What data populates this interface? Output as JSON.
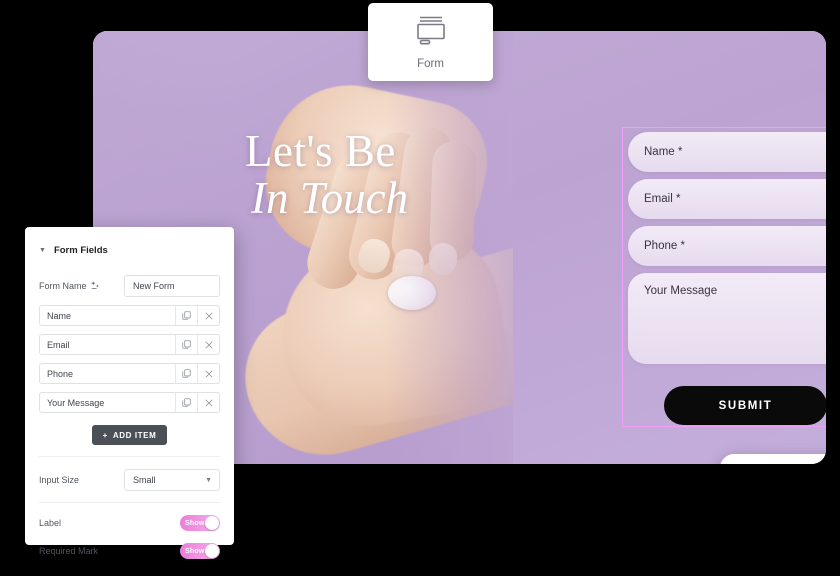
{
  "widget_chip": {
    "label": "Form",
    "icon": "form-widget-icon"
  },
  "hero": {
    "heading_line1": "Let's Be",
    "heading_line2": "In Touch"
  },
  "preview_form": {
    "fields": [
      {
        "label": "Name *"
      },
      {
        "label": "Email *"
      },
      {
        "label": "Phone *"
      },
      {
        "label": "Your Message"
      }
    ],
    "submit_label": "SUBMIT",
    "edit_badge_icon": "pencil-icon",
    "selection_color": "#ef9ff5"
  },
  "toast": {
    "status_icon": "check-icon",
    "check_color": "#0f5c3e",
    "avatars": [
      {
        "name": "avatar-1",
        "bg": "#f7c9dd"
      },
      {
        "name": "avatar-2",
        "bg": "#f0a55a"
      },
      {
        "name": "avatar-3",
        "bg": "#cdeede"
      }
    ]
  },
  "panel": {
    "section_title": "Form Fields",
    "collapse_icon": "caret-down-icon",
    "form_name": {
      "label": "Form Name",
      "dynamic_icon": "dynamic-tags-icon",
      "value": "New Form"
    },
    "fields": [
      {
        "name": "Name",
        "duplicate_icon": "duplicate-icon",
        "remove_icon": "close-icon"
      },
      {
        "name": "Email",
        "duplicate_icon": "duplicate-icon",
        "remove_icon": "close-icon"
      },
      {
        "name": "Phone",
        "duplicate_icon": "duplicate-icon",
        "remove_icon": "close-icon"
      },
      {
        "name": "Your Message",
        "duplicate_icon": "duplicate-icon",
        "remove_icon": "close-icon"
      }
    ],
    "add_item_label": "ADD ITEM",
    "add_item_icon": "plus-icon",
    "input_size": {
      "label": "Input Size",
      "value": "Small",
      "chevron": "chevron-down-icon"
    },
    "label_toggle": {
      "label": "Label",
      "state": "Show"
    },
    "required_mark_toggle": {
      "label": "Required Mark",
      "state": "Show"
    }
  },
  "colors": {
    "page_bg": "#000000",
    "canvas_bg": "#bfa6d4",
    "accent_pink": "#ef9ff5",
    "toggle_pink": "#ea86da",
    "button_dark": "#0a0a0a"
  }
}
